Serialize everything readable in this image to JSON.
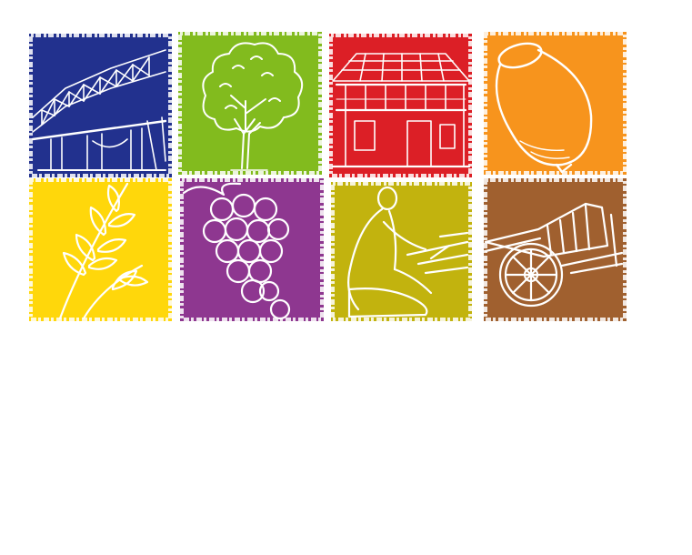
{
  "tiles": [
    {
      "name": "bridge-tile",
      "icon": "bridge-icon",
      "color": "#22318e"
    },
    {
      "name": "tree-tile",
      "icon": "tree-icon",
      "color": "#82bb1e"
    },
    {
      "name": "house-tile",
      "icon": "house-icon",
      "color": "#dc1f26"
    },
    {
      "name": "pot-tile",
      "icon": "pot-icon",
      "color": "#f7941d"
    },
    {
      "name": "wheat-tile",
      "icon": "wheat-icon",
      "color": "#ffd70b"
    },
    {
      "name": "grapes-tile",
      "icon": "grapes-icon",
      "color": "#8e3790"
    },
    {
      "name": "weaver-tile",
      "icon": "weaver-icon",
      "color": "#c2b30e"
    },
    {
      "name": "cart-tile",
      "icon": "bullock-cart-icon",
      "color": "#a0602f"
    }
  ],
  "colors": {
    "background": "#ffffff",
    "line_art": "#ffffff"
  }
}
